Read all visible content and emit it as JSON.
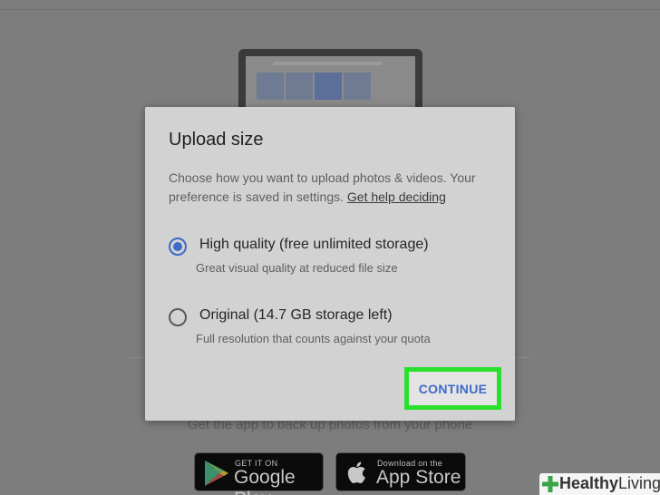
{
  "dialog": {
    "title": "Upload size",
    "description": "Choose how you want to upload photos & videos. Your preference is saved in settings.",
    "help_link": "Get help deciding",
    "options": [
      {
        "label": "High quality (free unlimited storage)",
        "sublabel": "Great visual quality at reduced file size",
        "selected": true
      },
      {
        "label": "Original (14.7 GB storage left)",
        "sublabel": "Full resolution that counts against your quota",
        "selected": false
      }
    ],
    "continue_label": "CONTINUE",
    "accent_color": "#3f6ac8",
    "highlight_color": "#27e12c"
  },
  "background": {
    "caption": "Get the app to back up photos from your phone",
    "google_play": {
      "small": "GET IT ON",
      "big": "Google Play",
      "icon": "play-store-icon"
    },
    "app_store": {
      "small": "Download on the",
      "big": "App Store",
      "icon": "apple-icon"
    }
  },
  "watermark": {
    "bold": "Healthy",
    "rest": "Living",
    "icon": "plus-icon"
  }
}
